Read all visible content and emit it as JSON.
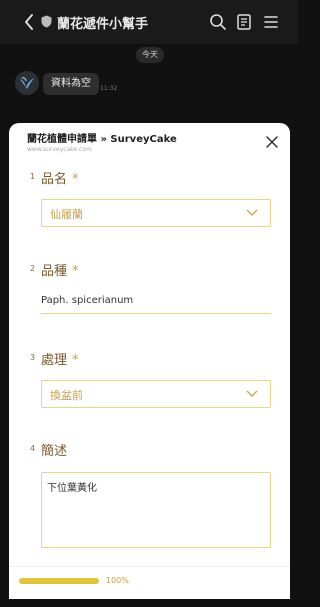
{
  "chat": {
    "title": "蘭花遞件小幫手",
    "date_label": "今天",
    "message": "資料為空",
    "message_time": "11:32"
  },
  "form": {
    "title": "蘭花植體申請單 » SurveyCake",
    "subtitle": "www.surveycake.com",
    "questions": [
      {
        "number": "1",
        "label": "品名",
        "required_mark": "*",
        "type": "select",
        "value": "仙履蘭"
      },
      {
        "number": "2",
        "label": "品種",
        "required_mark": "*",
        "type": "text",
        "value": "Paph. spicerianum"
      },
      {
        "number": "3",
        "label": "處理",
        "required_mark": "*",
        "type": "select",
        "value": "換盆前"
      },
      {
        "number": "4",
        "label": "簡述",
        "required_mark": "",
        "type": "textarea",
        "value": "下位葉黃化"
      }
    ],
    "progress_fraction": 1.0,
    "progress_label": "100%"
  },
  "colors": {
    "accent": "#e0c43b",
    "label_brown": "#7a5a2e",
    "field_border": "#e8d58a"
  },
  "icons": [
    "back-arrow-icon",
    "shield-icon",
    "search-icon",
    "notes-icon",
    "menu-icon",
    "close-icon",
    "chevron-down-icon"
  ]
}
